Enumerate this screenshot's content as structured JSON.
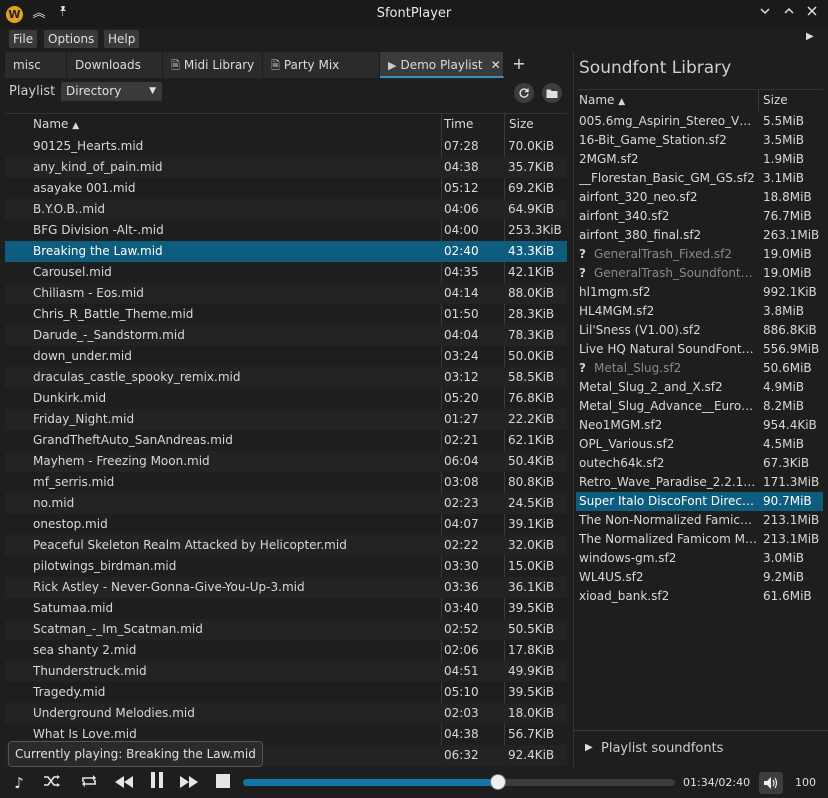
{
  "window": {
    "title": "SfontPlayer",
    "logo_letter": "W"
  },
  "menu": [
    "File",
    "Options",
    "Help"
  ],
  "tabs": [
    {
      "label": "misc",
      "icon": ""
    },
    {
      "label": "Downloads",
      "icon": ""
    },
    {
      "label": "Midi Library",
      "icon": "folder-icon"
    },
    {
      "label": "Party Mix",
      "icon": "folder-icon"
    },
    {
      "label": "Demo Playlist",
      "icon": "play-icon",
      "active": true
    }
  ],
  "playlist": {
    "label": "Playlist",
    "mode": "Directory"
  },
  "table": {
    "headers": {
      "name": "Name",
      "time": "Time",
      "size": "Size"
    },
    "rows": [
      {
        "name": "90125_Hearts.mid",
        "time": "07:28",
        "size": "70.0KiB"
      },
      {
        "name": "any_kind_of_pain.mid",
        "time": "04:38",
        "size": "35.7KiB"
      },
      {
        "name": "asayake 001.mid",
        "time": "05:12",
        "size": "69.2KiB"
      },
      {
        "name": "B.Y.O.B..mid",
        "time": "04:06",
        "size": "64.9KiB"
      },
      {
        "name": "BFG Division -Alt-.mid",
        "time": "04:00",
        "size": "253.3KiB"
      },
      {
        "name": "Breaking the Law.mid",
        "time": "02:40",
        "size": "43.3KiB",
        "selected": true
      },
      {
        "name": "Carousel.mid",
        "time": "04:35",
        "size": "42.1KiB"
      },
      {
        "name": "Chiliasm - Eos.mid",
        "time": "04:14",
        "size": "88.0KiB"
      },
      {
        "name": "Chris_R_Battle_Theme.mid",
        "time": "01:50",
        "size": "28.3KiB"
      },
      {
        "name": "Darude_-_Sandstorm.mid",
        "time": "04:04",
        "size": "78.3KiB"
      },
      {
        "name": "down_under.mid",
        "time": "03:24",
        "size": "50.0KiB"
      },
      {
        "name": "draculas_castle_spooky_remix.mid",
        "time": "03:12",
        "size": "58.5KiB"
      },
      {
        "name": "Dunkirk.mid",
        "time": "05:20",
        "size": "76.8KiB"
      },
      {
        "name": "Friday_Night.mid",
        "time": "01:27",
        "size": "22.2KiB"
      },
      {
        "name": "GrandTheftAuto_SanAndreas.mid",
        "time": "02:21",
        "size": "62.1KiB"
      },
      {
        "name": "Mayhem - Freezing Moon.mid",
        "time": "06:04",
        "size": "50.4KiB"
      },
      {
        "name": "mf_serris.mid",
        "time": "03:08",
        "size": "80.8KiB"
      },
      {
        "name": "no.mid",
        "time": "02:23",
        "size": "24.5KiB"
      },
      {
        "name": "onestop.mid",
        "time": "04:07",
        "size": "39.1KiB"
      },
      {
        "name": "Peaceful Skeleton Realm Attacked by Helicopter.mid",
        "time": "02:22",
        "size": "32.0KiB"
      },
      {
        "name": "pilotwings_birdman.mid",
        "time": "03:30",
        "size": "15.0KiB"
      },
      {
        "name": "Rick Astley - Never-Gonna-Give-You-Up-3.mid",
        "time": "03:36",
        "size": "36.1KiB"
      },
      {
        "name": "Satumaa.mid",
        "time": "03:40",
        "size": "39.5KiB"
      },
      {
        "name": "Scatman_-_Im_Scatman.mid",
        "time": "02:52",
        "size": "50.5KiB"
      },
      {
        "name": "sea shanty 2.mid",
        "time": "02:06",
        "size": "17.8KiB"
      },
      {
        "name": "Thunderstruck.mid",
        "time": "04:51",
        "size": "49.9KiB"
      },
      {
        "name": "Tragedy.mid",
        "time": "05:10",
        "size": "39.5KiB"
      },
      {
        "name": "Underground Melodies.mid",
        "time": "02:03",
        "size": "18.0KiB"
      },
      {
        "name": "What Is Love.mid",
        "time": "04:38",
        "size": "56.7KiB"
      },
      {
        "name": "",
        "time": "06:32",
        "size": "92.4KiB"
      }
    ]
  },
  "tooltip": "Currently playing: Breaking the Law.mid",
  "soundfonts": {
    "title": "Soundfont Library",
    "headers": {
      "name": "Name",
      "size": "Size"
    },
    "rows": [
      {
        "name": "005.6mg_Aspirin_Stereo_V1...",
        "size": "5.5MiB"
      },
      {
        "name": "16-Bit_Game_Station.sf2",
        "size": "3.5MiB"
      },
      {
        "name": "2MGM.sf2",
        "size": "1.9MiB"
      },
      {
        "name": "__Florestan_Basic_GM_GS.sf2",
        "size": "3.1MiB"
      },
      {
        "name": "airfont_320_neo.sf2",
        "size": "18.8MiB"
      },
      {
        "name": "airfont_340.sf2",
        "size": "76.7MiB"
      },
      {
        "name": "airfont_380_final.sf2",
        "size": "263.1MiB"
      },
      {
        "name": "GeneralTrash_Fixed.sf2",
        "size": "19.0MiB",
        "missing": true
      },
      {
        "name": "GeneralTrash_Soundfont_...",
        "size": "19.0MiB",
        "missing": true
      },
      {
        "name": "hl1mgm.sf2",
        "size": "992.1KiB"
      },
      {
        "name": "HL4MGM.sf2",
        "size": "3.8MiB"
      },
      {
        "name": "Lil'Sness (V1.00).sf2",
        "size": "886.8KiB"
      },
      {
        "name": "Live HQ Natural SoundFont G...",
        "size": "556.9MiB"
      },
      {
        "name": "Metal_Slug.sf2",
        "size": "50.6MiB",
        "missing": true
      },
      {
        "name": "Metal_Slug_2_and_X.sf2",
        "size": "4.9MiB"
      },
      {
        "name": "Metal_Slug_Advance__Europ...",
        "size": "8.2MiB"
      },
      {
        "name": "Neo1MGM.sf2",
        "size": "954.4KiB"
      },
      {
        "name": "OPL_Various.sf2",
        "size": "4.5MiB"
      },
      {
        "name": "outech64k.sf2",
        "size": "67.3KiB"
      },
      {
        "name": "Retro_Wave_Paradise_2.2.1.sf2",
        "size": "171.3MiB"
      },
      {
        "name": "Super Italo DiscoFont Directo...",
        "size": "90.7MiB",
        "selected": true
      },
      {
        "name": "The Non-Normalized Famico...",
        "size": "213.1MiB"
      },
      {
        "name": "The Normalized Famicom Mu...",
        "size": "213.1MiB"
      },
      {
        "name": "windows-gm.sf2",
        "size": "3.0MiB"
      },
      {
        "name": "WL4US.sf2",
        "size": "9.2MiB"
      },
      {
        "name": "xioad_bank.sf2",
        "size": "61.6MiB"
      }
    ],
    "footer": "Playlist soundfonts",
    "missing_marker": "?"
  },
  "player": {
    "elapsed": "01:34",
    "total": "02:40",
    "time_readout": "01:34/02:40",
    "progress": 0.5875,
    "volume": "100"
  },
  "colors": {
    "accent": "#0e5c7e",
    "seek_fill": "#1277a6",
    "logo": "#e3a21a"
  }
}
